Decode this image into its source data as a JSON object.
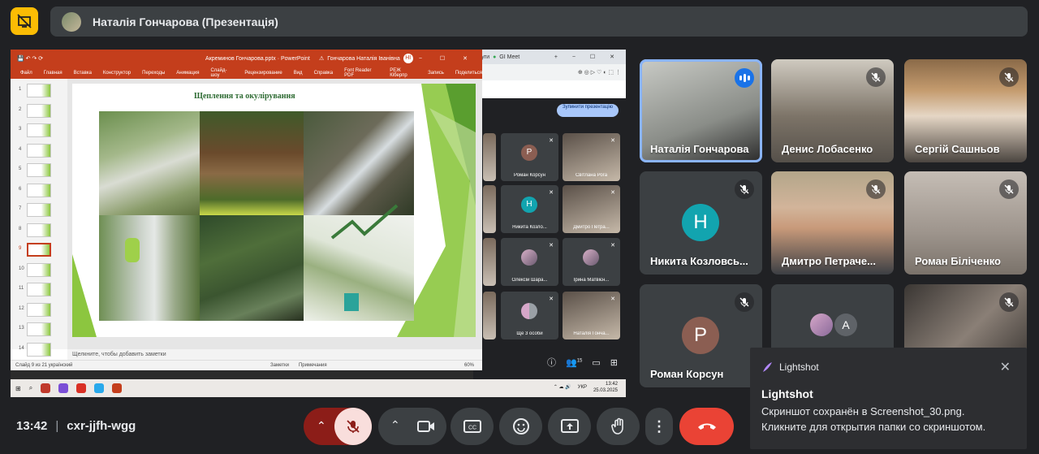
{
  "header": {
    "title": "Наталія Гончарова (Презентація)"
  },
  "shared_screen": {
    "ppt": {
      "window_title": "Акреминов Гончарова.pptx  ·  PowerPoint",
      "user_name": "Гончарова Наталія Іванівна",
      "user_initials": "НІ",
      "menu": [
        "Файл",
        "Главная",
        "Вставка",
        "Конструктор",
        "Переходы",
        "Анимация",
        "Слайд-шоу",
        "Рецензирование",
        "Вид",
        "Справка",
        "Font Reader PDF",
        "РЕЖ Кіберпр",
        "Запись",
        "Поделиться"
      ],
      "slide_title": "Щеплення та окулірування",
      "thumb_numbers": [
        "1",
        "2",
        "3",
        "4",
        "5",
        "6",
        "7",
        "8",
        "9",
        "10",
        "11",
        "12",
        "13",
        "14"
      ],
      "selected_thumb": "9",
      "notes_placeholder": "Щелкните, чтобы добавить заметки",
      "status_left": "Слайд 9 из 21   українский",
      "status_notes": "Заметки",
      "status_comments": "Примечания",
      "zoom": "60%"
    },
    "browser": {
      "tabs": [
        "дуги",
        "GI Meet"
      ],
      "stop_button": "Зупинити презентацію"
    },
    "mini_tiles": [
      {
        "name": "",
        "type": "video"
      },
      {
        "name": "Роман Корсун",
        "initial": "Р",
        "color": "#8b5e52"
      },
      {
        "name": "Світлана Рога",
        "type": "video"
      },
      {
        "name": "",
        "type": "video"
      },
      {
        "name": "Никита Козло...",
        "initial": "Н",
        "color": "#12a4af"
      },
      {
        "name": "Дмитро Петра...",
        "type": "video"
      },
      {
        "name": "",
        "type": "video"
      },
      {
        "name": "Олексій Шара...",
        "type": "avatar"
      },
      {
        "name": "Ірина Матвієн...",
        "type": "avatar"
      },
      {
        "name": "",
        "type": "video"
      },
      {
        "name": "Ще 3 особи",
        "type": "group"
      },
      {
        "name": "Наталія Гонча...",
        "type": "video"
      }
    ],
    "mini_count": "15",
    "taskbar": {
      "lang": "УКР",
      "time": "13:42",
      "date": "25.03.2025"
    }
  },
  "participants": [
    {
      "name": "Наталія Гончарова",
      "speaking": true
    },
    {
      "name": "Денис Лобасенко",
      "muted": true
    },
    {
      "name": "Сергій Сашньов",
      "muted": true
    },
    {
      "name": "Никита Козловсь...",
      "muted": true,
      "initial": "Н",
      "color": "#12a4af"
    },
    {
      "name": "Дмитро Петраче...",
      "muted": true
    },
    {
      "name": "Роман Біліченко",
      "muted": true
    },
    {
      "name": "Роман Корсун",
      "muted": true,
      "initial": "Р",
      "color": "#8b5e52"
    },
    {
      "name": "",
      "group_initial": "А"
    },
    {
      "name": "",
      "muted": true
    }
  ],
  "bottom": {
    "time": "13:42",
    "meeting_code": "cxr-jjfh-wgg"
  },
  "toast": {
    "app": "Lightshot",
    "title": "Lightshot",
    "line1": "Скриншот сохранён в Screenshot_30.png.",
    "line2": "Кликните для открытия папки со скриншотом.",
    "close": "✕"
  },
  "colors": {
    "accent": "#8ab4f8",
    "end_call": "#ea4335",
    "ppt_red": "#c43e1c",
    "warning": "#fbbc04"
  }
}
